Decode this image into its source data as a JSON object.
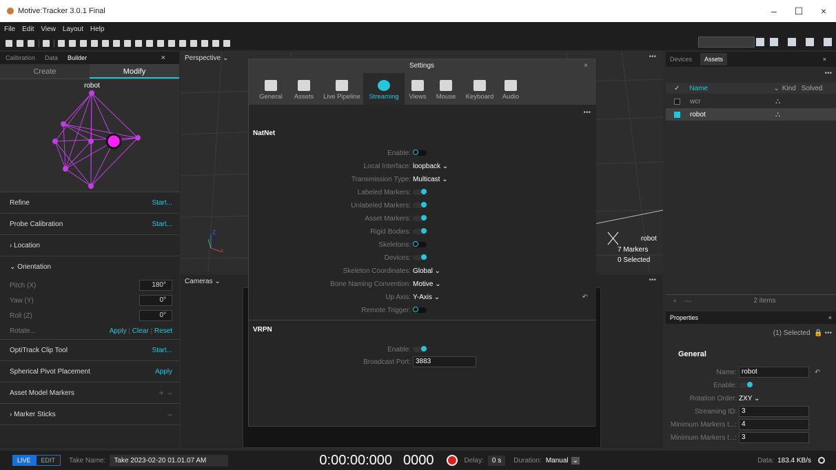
{
  "app": {
    "title": "Motive:Tracker 3.0.1 Final",
    "window_controls": [
      "–",
      "☐",
      "×"
    ]
  },
  "menu": [
    "File",
    "Edit",
    "View",
    "Layout",
    "Help"
  ],
  "left_panel": {
    "tabs": [
      "Calibration",
      "Data",
      "Builder"
    ],
    "active_tab": "Builder",
    "close": "×",
    "modes": [
      "Create",
      "Modify"
    ],
    "active_mode": "Modify",
    "robot_label": "robot",
    "sections": {
      "refine": {
        "label": "Refine",
        "action": "Start..."
      },
      "probe": {
        "label": "Probe Calibration",
        "action": "Start..."
      },
      "location": {
        "label": "Location",
        "chevron": "›"
      },
      "orientation": {
        "label": "Orientation",
        "chevron": "⌄"
      },
      "pitch": {
        "label": "Pitch (X)",
        "value": "180°"
      },
      "yaw": {
        "label": "Yaw (Y)",
        "value": "0°"
      },
      "roll": {
        "label": "Roll (Z)",
        "value": "0°"
      },
      "rotate": {
        "label": "Rotate...",
        "apply": "Apply",
        "clear": "Clear",
        "reset": "Reset",
        "sep": "|"
      },
      "clip": {
        "label": "OptiTrack Clip Tool",
        "action": "Start..."
      },
      "pivot": {
        "label": "Spherical Pivot Placement",
        "action": "Apply"
      },
      "amm": {
        "label": "Asset Model Markers",
        "plus": "+",
        "minus": "–"
      },
      "sticks": {
        "label": "Marker Sticks",
        "chevron": "›",
        "minus": "–"
      }
    }
  },
  "viewport": {
    "title": "Perspective ⌄",
    "dots": "•••",
    "asset_name": "robot",
    "markers": "7 Markers",
    "selected": "0 Selected",
    "axis_z": "Z",
    "axis_x": "x"
  },
  "cameras": {
    "title": "Cameras ⌄",
    "dots": "•••"
  },
  "settings": {
    "title": "Settings",
    "close": "×",
    "dots": "•••",
    "tabs": [
      "General",
      "Assets",
      "Live Pipeline",
      "Streaming",
      "Views",
      "Mouse",
      "Keyboard",
      "Audio"
    ],
    "active_tab": "Streaming",
    "natnet": {
      "header": "NatNet",
      "enable": {
        "label": "Enable:",
        "on": false
      },
      "local_interface": {
        "label": "Local Interface:",
        "value": "loopback ⌄"
      },
      "transmission": {
        "label": "Transmission Type:",
        "value": "Multicast ⌄"
      },
      "labeled": {
        "label": "Labeled Markers:",
        "on": true
      },
      "unlabeled": {
        "label": "Unlabeled Markers:",
        "on": true
      },
      "asset_markers": {
        "label": "Asset Markers:",
        "on": true
      },
      "rigid": {
        "label": "Rigid Bodies:",
        "on": true
      },
      "skeletons": {
        "label": "Skeletons:",
        "on": false
      },
      "devices": {
        "label": "Devices:",
        "on": true
      },
      "skel_coords": {
        "label": "Skeleton Coordinates:",
        "value": "Global ⌄"
      },
      "bone_naming": {
        "label": "Bone Naming Convention:",
        "value": "Motive ⌄"
      },
      "up_axis": {
        "label": "Up Axis:",
        "value": "Y-Axis ⌄",
        "reset": "↶"
      },
      "remote_trigger": {
        "label": "Remote Trigger:",
        "on": false
      }
    },
    "vrpn": {
      "header": "VRPN",
      "enable": {
        "label": "Enable:",
        "on": true
      },
      "port": {
        "label": "Broadcast Port:",
        "value": "3883"
      }
    }
  },
  "assets": {
    "tabs": [
      "Devices",
      "Assets"
    ],
    "active_tab": "Assets",
    "close": "×",
    "dots": "•••",
    "columns": {
      "check": "✓",
      "name": "Name",
      "kind": "Kind",
      "solved": "Solved",
      "sort": "⌄"
    },
    "rows": [
      {
        "name": "wcr",
        "checked": false,
        "kind": "⛬"
      },
      {
        "name": "robot",
        "checked": true,
        "kind": "⛬"
      }
    ],
    "count": "2 items",
    "plus": "+",
    "minus": "—"
  },
  "properties": {
    "title": "Properties",
    "close": "×",
    "selected": "(1) Selected",
    "lock": "🔒",
    "dots": "•••",
    "section": "General",
    "name": {
      "label": "Name:",
      "value": "robot",
      "reset": "↶"
    },
    "enable": {
      "label": "Enable:",
      "on": true
    },
    "rotation": {
      "label": "Rotation Order:",
      "value": "ZXY ⌄"
    },
    "stream_id": {
      "label": "Streaming ID:",
      "value": "3"
    },
    "min1": {
      "label": "Minimum Markers t...:",
      "value": "4"
    },
    "min2": {
      "label": "Minimum Markers t...:",
      "value": "3"
    }
  },
  "status": {
    "live": "LIVE",
    "edit": "EDIT",
    "take_label": "Take Name:",
    "take_value": "Take 2023-02-20 01.01.07 AM",
    "timecode": "0:00:00:000",
    "frame": "0000",
    "delay_label": "Delay:",
    "delay_value": "0 s",
    "duration_label": "Duration:",
    "duration_value": "Manual",
    "duration_arrow": "⌄",
    "data_label": "Data:",
    "data_value": "183.4 KB/s"
  }
}
